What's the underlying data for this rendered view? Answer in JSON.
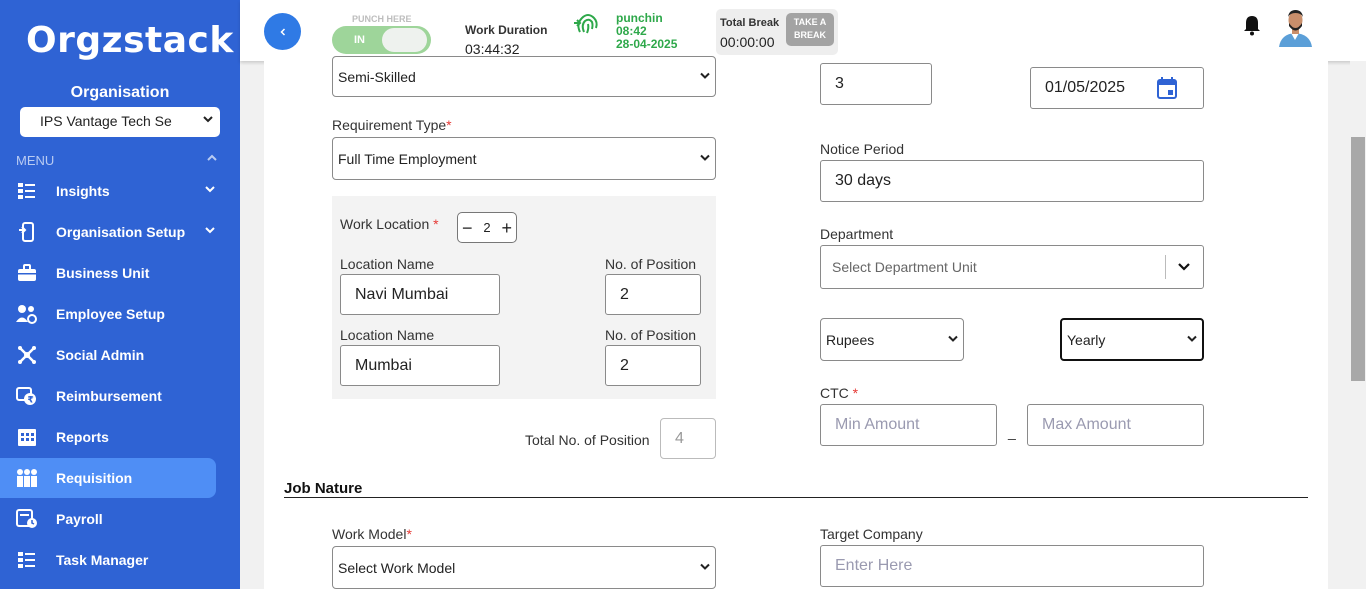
{
  "brand": {
    "logo_text": "Orgzstack"
  },
  "sidebar": {
    "org_label": "Organisation",
    "org_selected": "IPS Vantage Tech Se",
    "menu_label": "MENU",
    "items": [
      {
        "label": "Insights",
        "icon": "insights-icon",
        "has_chevron": true
      },
      {
        "label": "Organisation Setup",
        "icon": "organisation-setup-icon",
        "has_chevron": true
      },
      {
        "label": "Business Unit",
        "icon": "briefcase-icon"
      },
      {
        "label": "Employee Setup",
        "icon": "employee-setup-icon"
      },
      {
        "label": "Social Admin",
        "icon": "social-admin-icon"
      },
      {
        "label": "Reimbursement",
        "icon": "reimbursement-icon"
      },
      {
        "label": "Reports",
        "icon": "reports-icon"
      },
      {
        "label": "Requisition",
        "icon": "requisition-icon",
        "active": true
      },
      {
        "label": "Payroll",
        "icon": "payroll-icon"
      },
      {
        "label": "Task Manager",
        "icon": "task-manager-icon"
      }
    ]
  },
  "header": {
    "punch_here": "PUNCH HERE",
    "toggle_label": "IN",
    "work_duration_label": "Work Duration",
    "work_duration_value": "03:44:32",
    "punch_status": "punchin",
    "punch_time": "08:42",
    "punch_date": "28-04-2025",
    "total_break_label": "Total Break",
    "total_break_value": "00:00:00",
    "take_break_line1": "TAKE A",
    "take_break_line2": "BREAK",
    "accent_color": "#2f63d4",
    "punch_color": "#2ea84a"
  },
  "form": {
    "skill_level_value": "Semi-Skilled",
    "requirement_type_label": "Requirement Type",
    "requirement_type_value": "Full Time Employment",
    "work_location_label": "Work Location",
    "work_location_count": "2",
    "locations": [
      {
        "name_label": "Location Name",
        "name_value": "Navi Mumbai",
        "positions_label": "No. of Position",
        "positions_value": "2"
      },
      {
        "name_label": "Location Name",
        "name_value": "Mumbai",
        "positions_label": "No. of Position",
        "positions_value": "2"
      }
    ],
    "total_positions_label": "Total No. of Position",
    "total_positions_value": "4",
    "experience_value": "3",
    "date_value": "01/05/2025",
    "notice_period_label": "Notice Period",
    "notice_period_value": "30 days",
    "department_label": "Department",
    "department_placeholder": "Select Department Unit",
    "currency_value": "Rupees",
    "period_value": "Yearly",
    "ctc_label": "CTC",
    "ctc_min_placeholder": "Min Amount",
    "ctc_max_placeholder": "Max Amount",
    "ctc_separator": "_",
    "job_nature_title": "Job Nature",
    "work_model_label": "Work Model",
    "work_model_value": "Select Work Model",
    "target_company_label": "Target Company",
    "target_company_placeholder": "Enter Here",
    "required_marker": "*"
  }
}
